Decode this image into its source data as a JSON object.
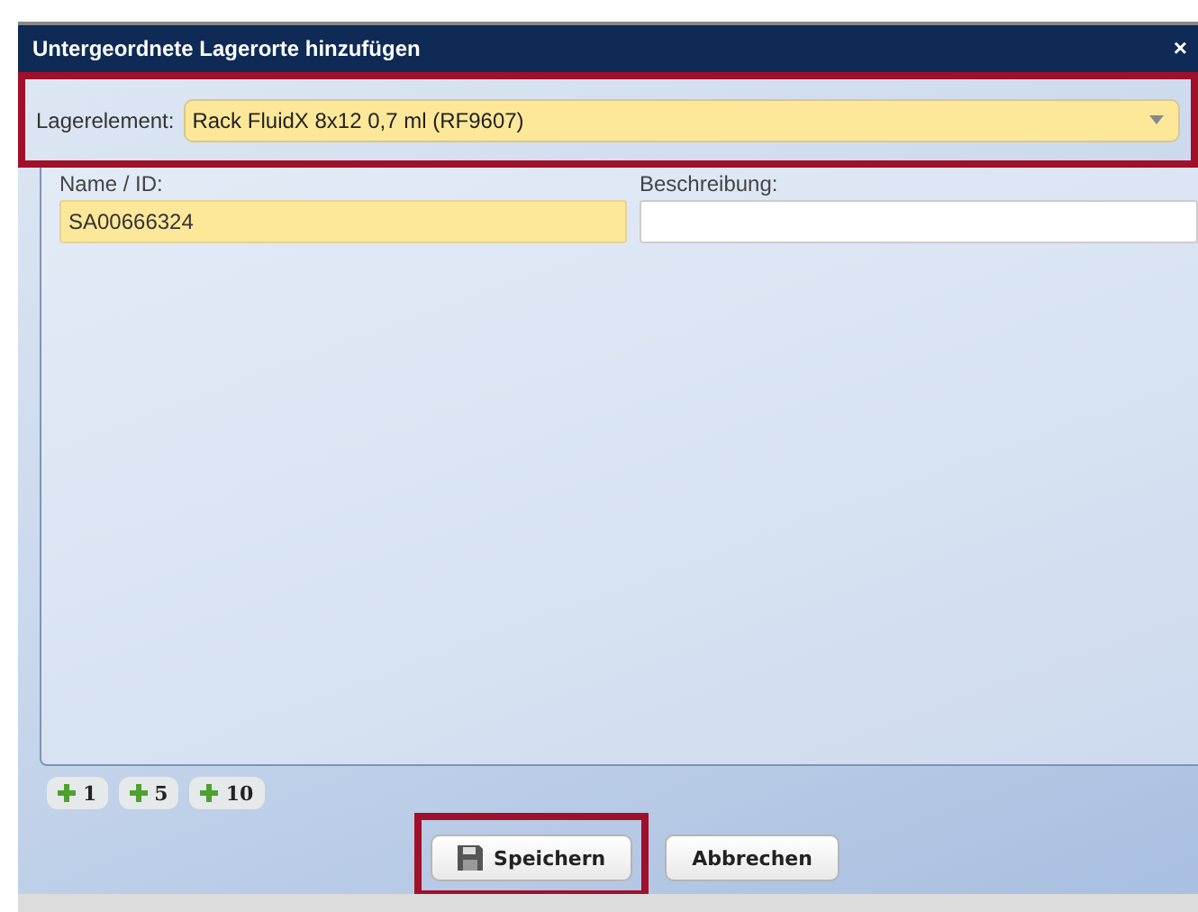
{
  "window": {
    "title": "Untergeordnete Lagerorte hinzufügen",
    "close": "×"
  },
  "storage_element": {
    "label": "Lagerelement:",
    "value": "Rack FluidX 8x12 0,7 ml (RF9607)",
    "highlighted": true
  },
  "fields": [
    {
      "label": "Name / ID:",
      "value": "SA00666324",
      "required": true
    },
    {
      "label": "Beschreibung:",
      "required": false
    }
  ],
  "add_buttons": [
    "1",
    "5",
    "10"
  ],
  "buttons": [
    {
      "kind": "save",
      "label": "Speichern",
      "highlighted": true
    },
    {
      "kind": "cancel",
      "label": "Abbrechen",
      "highlighted": false
    }
  ]
}
